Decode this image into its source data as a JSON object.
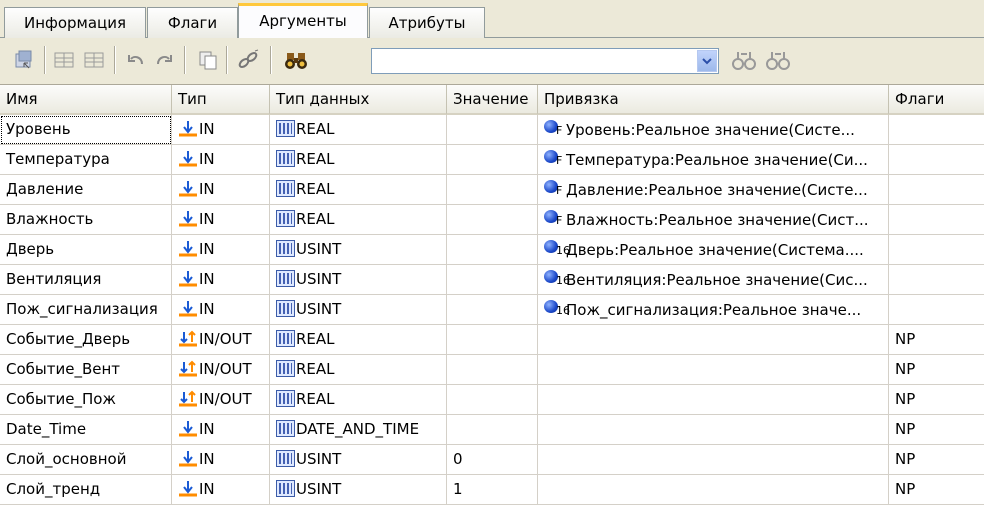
{
  "tabs": [
    {
      "label": "Информация"
    },
    {
      "label": "Флаги"
    },
    {
      "label": "Аргументы"
    },
    {
      "label": "Атрибуты"
    }
  ],
  "active_tab": 2,
  "search": {
    "value": ""
  },
  "columns": [
    "Имя",
    "Тип",
    "Тип данных",
    "Значение",
    "Привязка",
    "Флаги"
  ],
  "rows": [
    {
      "name": "Уровень",
      "type": "IN",
      "dtype": "REAL",
      "value": "",
      "binding": "Уровень:Реальное значение(Систе...",
      "binding_sub": "F",
      "flags": ""
    },
    {
      "name": "Температура",
      "type": "IN",
      "dtype": "REAL",
      "value": "",
      "binding": "Температура:Реальное значение(Си...",
      "binding_sub": "F",
      "flags": ""
    },
    {
      "name": "Давление",
      "type": "IN",
      "dtype": "REAL",
      "value": "",
      "binding": "Давление:Реальное значение(Систе...",
      "binding_sub": "F",
      "flags": ""
    },
    {
      "name": "Влажность",
      "type": "IN",
      "dtype": "REAL",
      "value": "",
      "binding": "Влажность:Реальное значение(Сист...",
      "binding_sub": "F",
      "flags": ""
    },
    {
      "name": "Дверь",
      "type": "IN",
      "dtype": "USINT",
      "value": "",
      "binding": "Дверь:Реальное значение(Система....",
      "binding_sub": "16",
      "flags": ""
    },
    {
      "name": "Вентиляция",
      "type": "IN",
      "dtype": "USINT",
      "value": "",
      "binding": "Вентиляция:Реальное значение(Сис...",
      "binding_sub": "16",
      "flags": ""
    },
    {
      "name": "Пож_сигнализация",
      "type": "IN",
      "dtype": "USINT",
      "value": "",
      "binding": "Пож_сигнализация:Реальное значе...",
      "binding_sub": "16",
      "flags": ""
    },
    {
      "name": "Событие_Дверь",
      "type": "IN/OUT",
      "dtype": "REAL",
      "value": "",
      "binding": "",
      "binding_sub": "",
      "flags": "NP"
    },
    {
      "name": "Событие_Вент",
      "type": "IN/OUT",
      "dtype": "REAL",
      "value": "",
      "binding": "",
      "binding_sub": "",
      "flags": "NP"
    },
    {
      "name": "Событие_Пож",
      "type": "IN/OUT",
      "dtype": "REAL",
      "value": "",
      "binding": "",
      "binding_sub": "",
      "flags": "NP"
    },
    {
      "name": "Date_Time",
      "type": "IN",
      "dtype": "DATE_AND_TIME",
      "value": "",
      "binding": "",
      "binding_sub": "",
      "flags": "NP"
    },
    {
      "name": "Слой_основной",
      "type": "IN",
      "dtype": "USINT",
      "value": "0",
      "binding": "",
      "binding_sub": "",
      "flags": "NP"
    },
    {
      "name": "Слой_тренд",
      "type": "IN",
      "dtype": "USINT",
      "value": "1",
      "binding": "",
      "binding_sub": "",
      "flags": "NP"
    }
  ],
  "colors": {
    "accent": "#ffc83c",
    "header": "#ece9d8",
    "binding_icon": "#1a47c8"
  }
}
